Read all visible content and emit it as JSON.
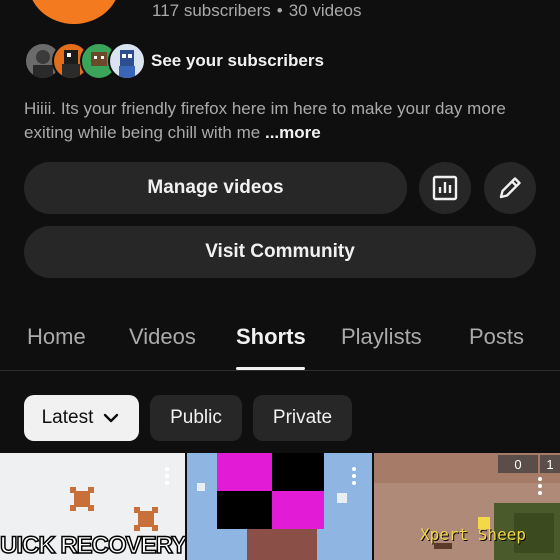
{
  "channel": {
    "subscribers": "117 subscribers",
    "separator": "•",
    "videos": "30 videos",
    "avatar_color": "#f47a1f"
  },
  "subscribers_row": {
    "label": "See your subscribers",
    "avatar_count": 4
  },
  "description": {
    "text": "Hiiii. Its your friendly firefox here im here to make your day more exiting while being chill with me",
    "more_label": "...more"
  },
  "actions": {
    "manage_videos": "Manage videos",
    "analytics_icon": "bar-chart-icon",
    "edit_icon": "pencil-icon",
    "visit_community": "Visit Community"
  },
  "tabs": [
    {
      "label": "Home",
      "active": false
    },
    {
      "label": "Videos",
      "active": false
    },
    {
      "label": "Shorts",
      "active": true
    },
    {
      "label": "Playlists",
      "active": false
    },
    {
      "label": "Posts",
      "active": false
    }
  ],
  "filters": {
    "latest": "Latest",
    "public": "Public",
    "private": "Private"
  },
  "shorts": [
    {
      "caption": "UICK RECOVERY"
    },
    {
      "caption": ""
    },
    {
      "caption": "Xpert Sheep",
      "hud_count_1": "0",
      "hud_count_2": "1"
    }
  ],
  "colors": {
    "background": "#0f0f0f",
    "surface": "#272727",
    "text_primary": "#f1f1f1",
    "text_secondary": "#aaaaaa"
  }
}
